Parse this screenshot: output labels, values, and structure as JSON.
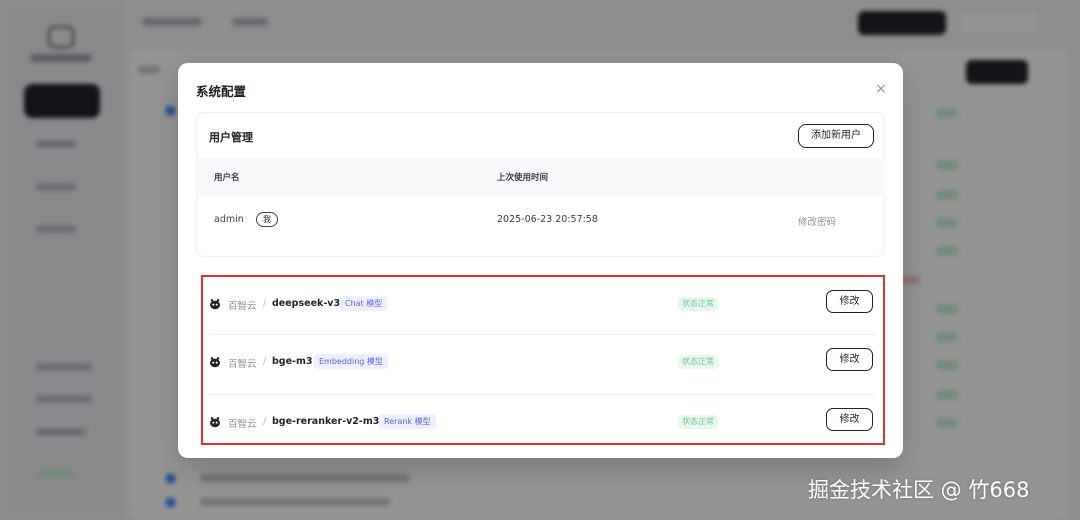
{
  "modal": {
    "title": "系统配置",
    "close_icon": "×"
  },
  "user_management": {
    "title": "用户管理",
    "add_user_label": "添加新用户",
    "columns": [
      "用户名",
      "上次使用时间"
    ],
    "rows": [
      {
        "username": "admin",
        "badge": "我",
        "last_used": "2025-06-23 20:57:58",
        "action": "修改密码"
      }
    ]
  },
  "models": [
    {
      "icon": "baidu-paw-icon",
      "provider": "百智云",
      "separator": "/",
      "name": "deepseek-v3",
      "tag": "Chat 模型",
      "status": "状态正常",
      "edit_label": "修改"
    },
    {
      "icon": "baidu-paw-icon",
      "provider": "百智云",
      "separator": "/",
      "name": "bge-m3",
      "tag": "Embedding 模型",
      "status": "状态正常",
      "edit_label": "修改"
    },
    {
      "icon": "baidu-paw-icon",
      "provider": "百智云",
      "separator": "/",
      "name": "bge-reranker-v2-m3",
      "tag": "Rerank 模型",
      "status": "状态正常",
      "edit_label": "修改"
    }
  ],
  "colors": {
    "highlight_border": "#e3302b",
    "status_bg": "#e9f8ef",
    "status_text": "#6dc490",
    "tag_bg": "#eef0ff",
    "tag_text": "#5966d8"
  },
  "watermark": "掘金技术社区 @ 竹668"
}
